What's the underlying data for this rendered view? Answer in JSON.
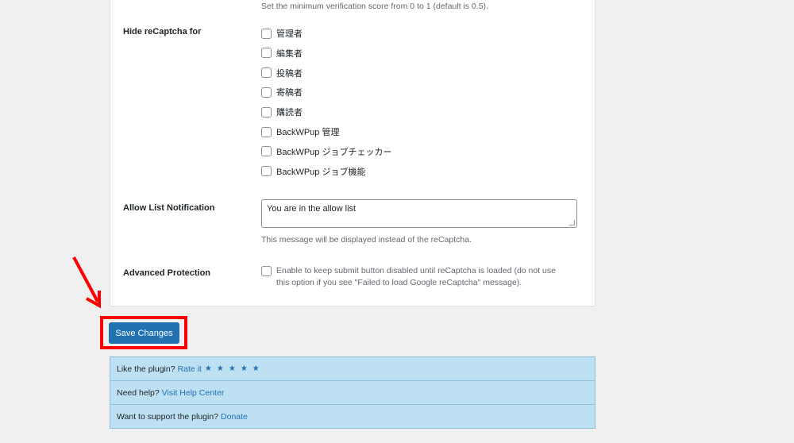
{
  "score_description": "Set the minimum verification score from 0 to 1 (default is 0.5).",
  "hide_recaptcha": {
    "label": "Hide reCaptcha for",
    "roles": [
      {
        "label": "管理者",
        "checked": false
      },
      {
        "label": "編集者",
        "checked": false
      },
      {
        "label": "投稿者",
        "checked": false
      },
      {
        "label": "寄稿者",
        "checked": false
      },
      {
        "label": "購読者",
        "checked": false
      },
      {
        "label": "BackWPup 管理",
        "checked": false
      },
      {
        "label": "BackWPup ジョブチェッカー",
        "checked": false
      },
      {
        "label": "BackWPup ジョブ機能",
        "checked": false
      }
    ]
  },
  "allow_list": {
    "label": "Allow List Notification",
    "value": "You are in the allow list",
    "description": "This message will be displayed instead of the reCaptcha."
  },
  "advanced": {
    "label": "Advanced Protection",
    "checked": false,
    "line1": "Enable to keep submit button disabled until reCaptcha is loaded (do not use",
    "line2": "this option if you see \"Failed to load Google reCaptcha\" message)."
  },
  "save_label": "Save Changes",
  "info": {
    "rate_text": "Like the plugin?",
    "rate_link": "Rate it",
    "stars": "★★★★★",
    "help_text": "Need help?",
    "help_link": "Visit Help Center",
    "donate_text": "Want to support the plugin?",
    "donate_link": "Donate"
  },
  "colors": {
    "accent": "#2271b1",
    "highlight": "#ff0000",
    "info_bg": "#bde0f3"
  }
}
